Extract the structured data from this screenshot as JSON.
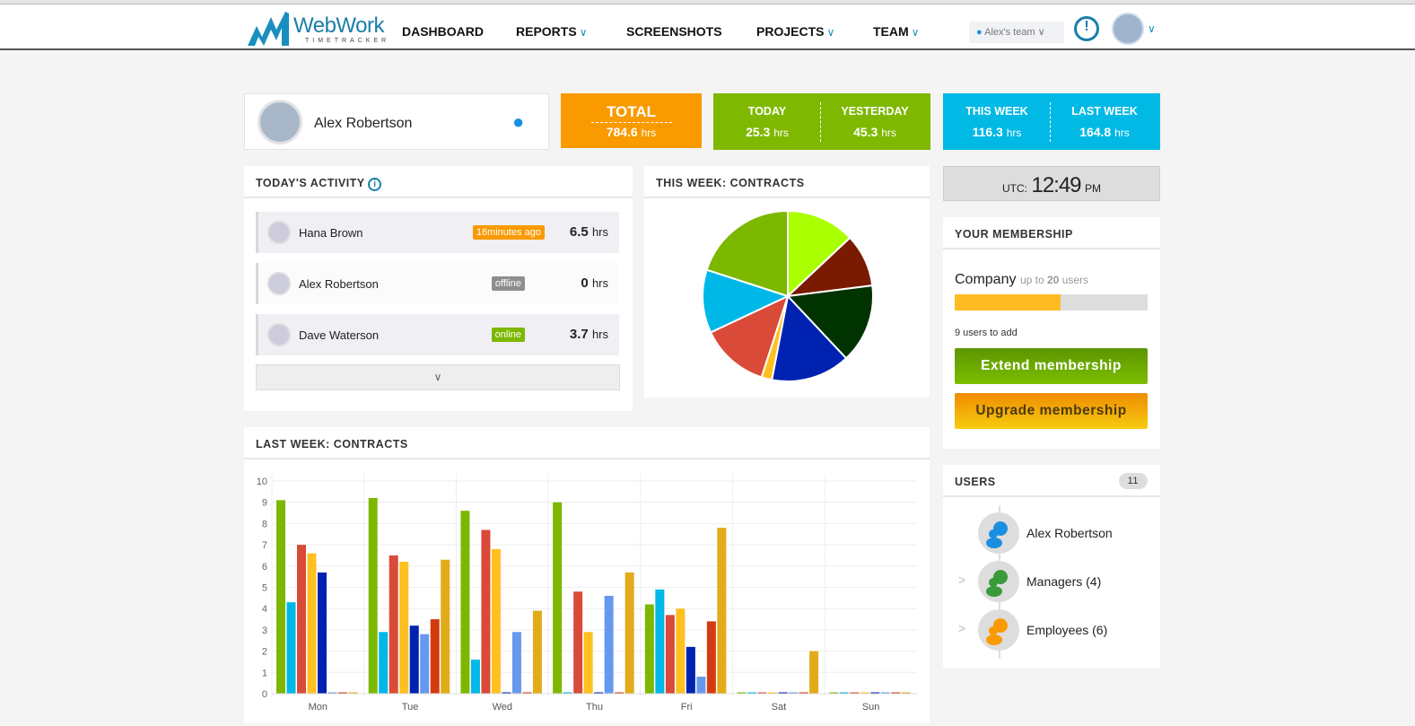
{
  "header": {
    "logo_text": "WebWork",
    "logo_sub": "TIMETRACKER",
    "nav": [
      {
        "label": "DASHBOARD",
        "dropdown": false
      },
      {
        "label": "REPORTS",
        "dropdown": true
      },
      {
        "label": "SCREENSHOTS",
        "dropdown": false
      },
      {
        "label": "PROJECTS",
        "dropdown": true
      },
      {
        "label": "TEAM",
        "dropdown": true
      }
    ],
    "team_selector": "Alex's team"
  },
  "profile": {
    "name": "Alex  Robertson"
  },
  "stats": {
    "total": {
      "label": "TOTAL",
      "value": "784.6",
      "unit": "hrs"
    },
    "today": {
      "label": "TODAY",
      "value": "25.3",
      "unit": "hrs"
    },
    "yesterday": {
      "label": "YESTERDAY",
      "value": "45.3",
      "unit": "hrs"
    },
    "this_week": {
      "label": "THIS WEEK",
      "value": "116.3",
      "unit": "hrs"
    },
    "last_week": {
      "label": "LAST WEEK",
      "value": "164.8",
      "unit": "hrs"
    }
  },
  "clock": {
    "prefix": "UTC:",
    "time": "12:49",
    "ampm": "PM"
  },
  "activity": {
    "title": "TODAY'S ACTIVITY",
    "rows": [
      {
        "name": "Hana  Brown",
        "status": "16minutes ago",
        "status_color": "#f99a00",
        "hours": "6.5",
        "unit": "hrs"
      },
      {
        "name": "Alex  Robertson",
        "status": "offline",
        "status_color": "#8e8e8e",
        "hours": "0",
        "unit": "hrs"
      },
      {
        "name": "Dave  Waterson",
        "status": "online",
        "status_color": "#7cb800",
        "hours": "3.7",
        "unit": "hrs"
      }
    ]
  },
  "membership": {
    "title": "YOUR MEMBERSHIP",
    "plan": "Company",
    "limit_pre": "up  to",
    "limit": "20",
    "limit_post": "users",
    "used_fraction": 0.55,
    "users_to_add": "9  users  to  add",
    "extend": "Extend  membership",
    "upgrade": "Upgrade  membership"
  },
  "users": {
    "title": "USERS",
    "count": "11",
    "items": [
      {
        "label": "Alex  Robertson",
        "color": "#1a8fe0"
      },
      {
        "label": "Managers  (4)",
        "color": "#3a9a3a"
      },
      {
        "label": "Employees  (6)",
        "color": "#f99a00"
      }
    ]
  },
  "chart_data": [
    {
      "type": "pie",
      "title": "THIS WEEK: CONTRACTS",
      "values": [
        13,
        10,
        15,
        15,
        2,
        13,
        12,
        20
      ],
      "colors": [
        "#aaff00",
        "#7a1a00",
        "#003300",
        "#0022b0",
        "#ffc020",
        "#d94a38",
        "#00b8e8",
        "#7cb800"
      ]
    },
    {
      "type": "bar",
      "title": "LAST WEEK: CONTRACTS",
      "categories": [
        "Mon",
        "Tue",
        "Wed",
        "Thu",
        "Fri",
        "Sat",
        "Sun"
      ],
      "ylim": [
        0,
        10
      ],
      "yticks": [
        "0",
        "1",
        "2",
        "3",
        "4",
        "5",
        "6",
        "7",
        "8",
        "9",
        "10"
      ],
      "series": [
        {
          "color": "#7cb800",
          "values": [
            9.1,
            9.2,
            8.6,
            9.0,
            4.2,
            0,
            0
          ]
        },
        {
          "color": "#00b8e8",
          "values": [
            4.3,
            2.9,
            1.6,
            0,
            4.9,
            0,
            0
          ]
        },
        {
          "color": "#d94a38",
          "values": [
            7.0,
            6.5,
            7.7,
            4.8,
            3.7,
            0,
            0
          ]
        },
        {
          "color": "#ffc020",
          "values": [
            6.6,
            6.2,
            6.8,
            2.9,
            4.0,
            0,
            0
          ]
        },
        {
          "color": "#0022b0",
          "values": [
            5.7,
            3.2,
            0,
            0,
            2.2,
            0,
            0
          ]
        },
        {
          "color": "#6699ee",
          "values": [
            0,
            2.8,
            2.9,
            4.6,
            0.8,
            0,
            0
          ]
        },
        {
          "color": "#d43a10",
          "values": [
            0,
            3.5,
            0,
            0,
            3.4,
            0,
            0
          ]
        },
        {
          "color": "#e2ac18",
          "values": [
            0,
            6.3,
            3.9,
            5.7,
            7.8,
            2.0,
            0
          ]
        }
      ]
    }
  ]
}
